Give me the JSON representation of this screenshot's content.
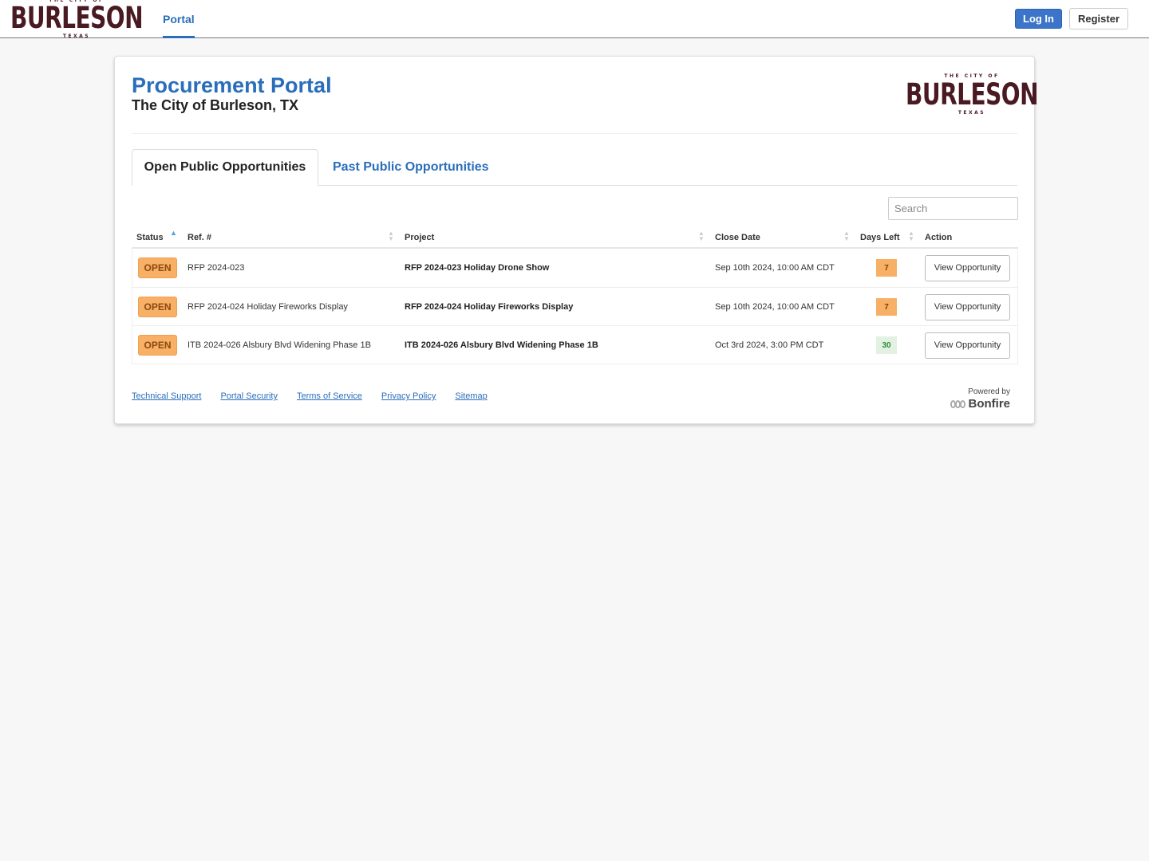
{
  "nav": {
    "logo": {
      "top": "THE CITY OF",
      "main": "BURLESON",
      "bottom": "TEXAS"
    },
    "portal_label": "Portal",
    "login_label": "Log In",
    "register_label": "Register"
  },
  "header": {
    "title": "Procurement Portal",
    "subtitle": "The City of Burleson, TX",
    "logo": {
      "top": "THE CITY OF",
      "main": "BURLESON",
      "bottom": "TEXAS"
    }
  },
  "tabs": [
    {
      "label": "Open Public Opportunities",
      "active": true
    },
    {
      "label": "Past Public Opportunities",
      "active": false
    }
  ],
  "search": {
    "placeholder": "Search",
    "value": ""
  },
  "table": {
    "columns": [
      "Status",
      "Ref. #",
      "Project",
      "Close Date",
      "Days Left",
      "Action"
    ],
    "rows": [
      {
        "status": "OPEN",
        "ref": "RFP 2024-023",
        "project": "RFP 2024-023 Holiday Drone Show",
        "close_date": "Sep 10th 2024, 10:00 AM CDT",
        "days_left": "7",
        "days_color": "#f7b065",
        "days_text_color": "#7a3f0a",
        "action": "View Opportunity"
      },
      {
        "status": "OPEN",
        "ref": "RFP 2024-024 Holiday Fireworks Display",
        "project": "RFP 2024-024 Holiday Fireworks Display",
        "close_date": "Sep 10th 2024, 10:00 AM CDT",
        "days_left": "7",
        "days_color": "#f7b065",
        "days_text_color": "#7a3f0a",
        "action": "View Opportunity"
      },
      {
        "status": "OPEN",
        "ref": "ITB 2024-026 Alsbury Blvd Widening Phase 1B",
        "project": "ITB 2024-026 Alsbury Blvd Widening Phase 1B",
        "close_date": "Oct 3rd 2024, 3:00 PM CDT",
        "days_left": "30",
        "days_color": "#e3f1e3",
        "days_text_color": "#2e8b3a",
        "action": "View Opportunity"
      }
    ]
  },
  "footer": {
    "links": [
      "Technical Support",
      "Portal Security",
      "Terms of Service",
      "Privacy Policy",
      "Sitemap"
    ],
    "powered_by": "Powered by",
    "brand": "Bonfire"
  },
  "colors": {
    "accent": "#2a6ebb",
    "login_button": "#3b74c8",
    "status_open": "#f7b065",
    "logo": "#4a1a22"
  }
}
